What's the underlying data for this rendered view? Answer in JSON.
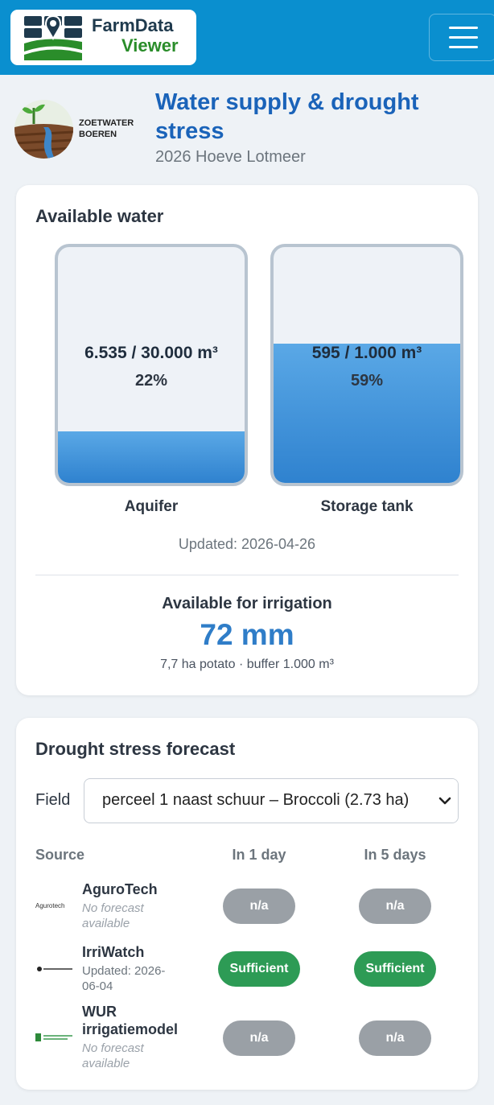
{
  "navbar": {
    "brand_line1": "FarmData",
    "brand_line2": "Viewer",
    "menu_icon": "hamburger-icon",
    "brand_color": "#0a8fcf"
  },
  "header": {
    "org_line1": "ZOETWATER",
    "org_line2": "BOEREN",
    "title": "Water supply & drought stress",
    "subtitle": "2026 Hoeve Lotmeer"
  },
  "available_water": {
    "title": "Available water",
    "aquifer": {
      "value_text": "6.535 / 30.000 m³",
      "percent_text": "22%",
      "fill_fraction": 0.22,
      "label": "Aquifer"
    },
    "storage": {
      "value_text": "595 / 1.000 m³",
      "percent_text": "59%",
      "fill_fraction": 0.59,
      "label": "Storage tank"
    },
    "updated": "Updated: 2026-04-26",
    "irrigation_label": "Available for irrigation",
    "irrigation_value": "72 mm",
    "irrigation_note": "7,7 ha potato · buffer 1.000 m³"
  },
  "forecast": {
    "title": "Drought stress forecast",
    "field_label": "Field",
    "field_value": "perceel 1 naast schuur – Broccoli (2.73 ha)",
    "columns": {
      "source": "Source",
      "day1": "In 1 day",
      "day5": "In 5 days"
    },
    "rows": [
      {
        "logo_text": "Agurotech",
        "name": "AguroTech",
        "status_line1": "No forecast",
        "status_line2": "available",
        "day1": "n/a",
        "day5": "n/a"
      },
      {
        "logo_text": "IrriWatch",
        "name": "IrriWatch",
        "status_line1": "Updated: 2026-",
        "status_line2": "06-04",
        "day1": "Sufficient",
        "day5": "Sufficient"
      },
      {
        "logo_text": "WUR",
        "name_line1": "WUR",
        "name_line2": "irrigatiemodel",
        "status_line1": "No forecast",
        "status_line2": "available",
        "day1": "n/a",
        "day5": "n/a"
      }
    ],
    "status_colors": {
      "na": "#9aa0a6",
      "sufficient": "#2d9b55"
    }
  }
}
